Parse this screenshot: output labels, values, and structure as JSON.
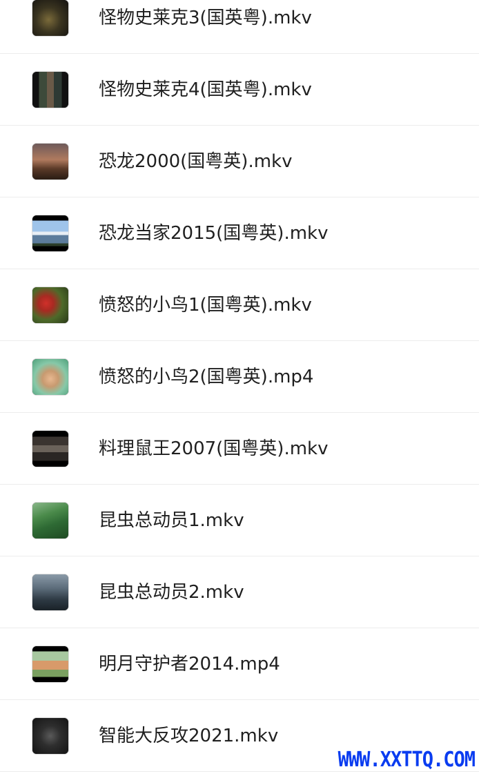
{
  "files": [
    {
      "name": "怪物史莱克3(国英粤).mkv",
      "thumb": "movie-thumbnail"
    },
    {
      "name": "怪物史莱克4(国英粤).mkv",
      "thumb": "movie-thumbnail"
    },
    {
      "name": "恐龙2000(国粤英).mkv",
      "thumb": "movie-thumbnail"
    },
    {
      "name": "恐龙当家2015(国粤英).mkv",
      "thumb": "movie-thumbnail"
    },
    {
      "name": "愤怒的小鸟1(国粤英).mkv",
      "thumb": "movie-thumbnail"
    },
    {
      "name": "愤怒的小鸟2(国粤英).mp4",
      "thumb": "movie-thumbnail"
    },
    {
      "name": "料理鼠王2007(国粤英).mkv",
      "thumb": "movie-thumbnail"
    },
    {
      "name": "昆虫总动员1.mkv",
      "thumb": "movie-thumbnail"
    },
    {
      "name": "昆虫总动员2.mkv",
      "thumb": "movie-thumbnail"
    },
    {
      "name": "明月守护者2014.mp4",
      "thumb": "movie-thumbnail"
    },
    {
      "name": "智能大反攻2021.mkv",
      "thumb": "movie-thumbnail"
    }
  ],
  "watermark": {
    "text": "WWW.XXTTQ.COM",
    "color": "#0a3cf0"
  }
}
